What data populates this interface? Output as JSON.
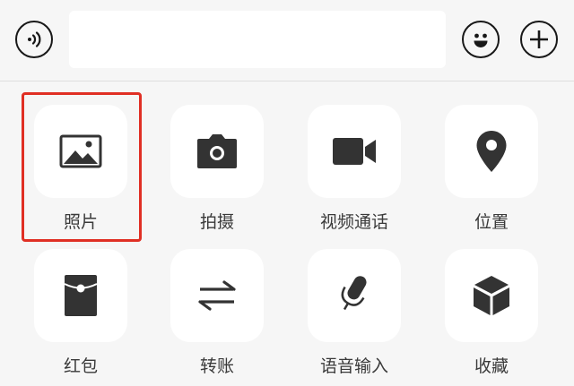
{
  "input_bar": {
    "voice_icon": "voice-wave-icon",
    "text_value": "",
    "emoji_icon": "smiley-face-icon",
    "more_icon": "plus-circle-icon"
  },
  "panel": {
    "items": [
      {
        "label": "照片",
        "icon": "image-icon",
        "highlighted": true
      },
      {
        "label": "拍摄",
        "icon": "camera-icon"
      },
      {
        "label": "视频通话",
        "icon": "video-camera-icon"
      },
      {
        "label": "位置",
        "icon": "location-pin-icon"
      },
      {
        "label": "红包",
        "icon": "red-envelope-icon"
      },
      {
        "label": "转账",
        "icon": "transfer-arrows-icon"
      },
      {
        "label": "语音输入",
        "icon": "microphone-icon"
      },
      {
        "label": "收藏",
        "icon": "cube-icon"
      }
    ]
  },
  "colors": {
    "background": "#f6f6f6",
    "tile": "#ffffff",
    "icon": "#333333",
    "highlight": "#e02f24"
  }
}
